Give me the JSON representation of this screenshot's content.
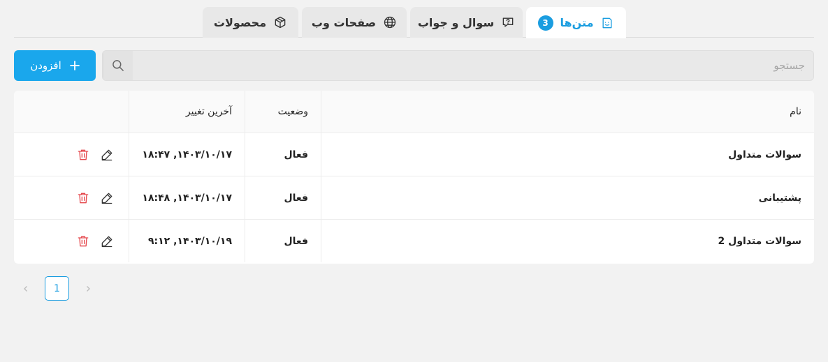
{
  "tabs": [
    {
      "label": "متن‌ها",
      "badge": "3",
      "icon": "note-icon",
      "active": true
    },
    {
      "label": "سوال و جواب",
      "icon": "question-chat-icon"
    },
    {
      "label": "صفحات وب",
      "icon": "globe-icon"
    },
    {
      "label": "محصولات",
      "icon": "box-icon"
    }
  ],
  "toolbar": {
    "add_label": "افزودن",
    "search_placeholder": "جستجو"
  },
  "table": {
    "headers": {
      "name": "نام",
      "status": "وضعیت",
      "last_modified": "آخرین تغییر"
    },
    "rows": [
      {
        "name": "سوالات متداول",
        "status": "فعال",
        "date": "۱۴۰۳/۱۰/۱۷, ۱۸:۴۷"
      },
      {
        "name": "پشتیبانی",
        "status": "فعال",
        "date": "۱۴۰۳/۱۰/۱۷, ۱۸:۴۸"
      },
      {
        "name": "سوالات متداول 2",
        "status": "فعال",
        "date": "۱۴۰۳/۱۰/۱۹, ۹:۱۲"
      }
    ]
  },
  "pagination": {
    "current": "1"
  },
  "colors": {
    "accent": "#1a9de0",
    "add_button": "#1aa7ec",
    "delete": "#e5484d"
  }
}
